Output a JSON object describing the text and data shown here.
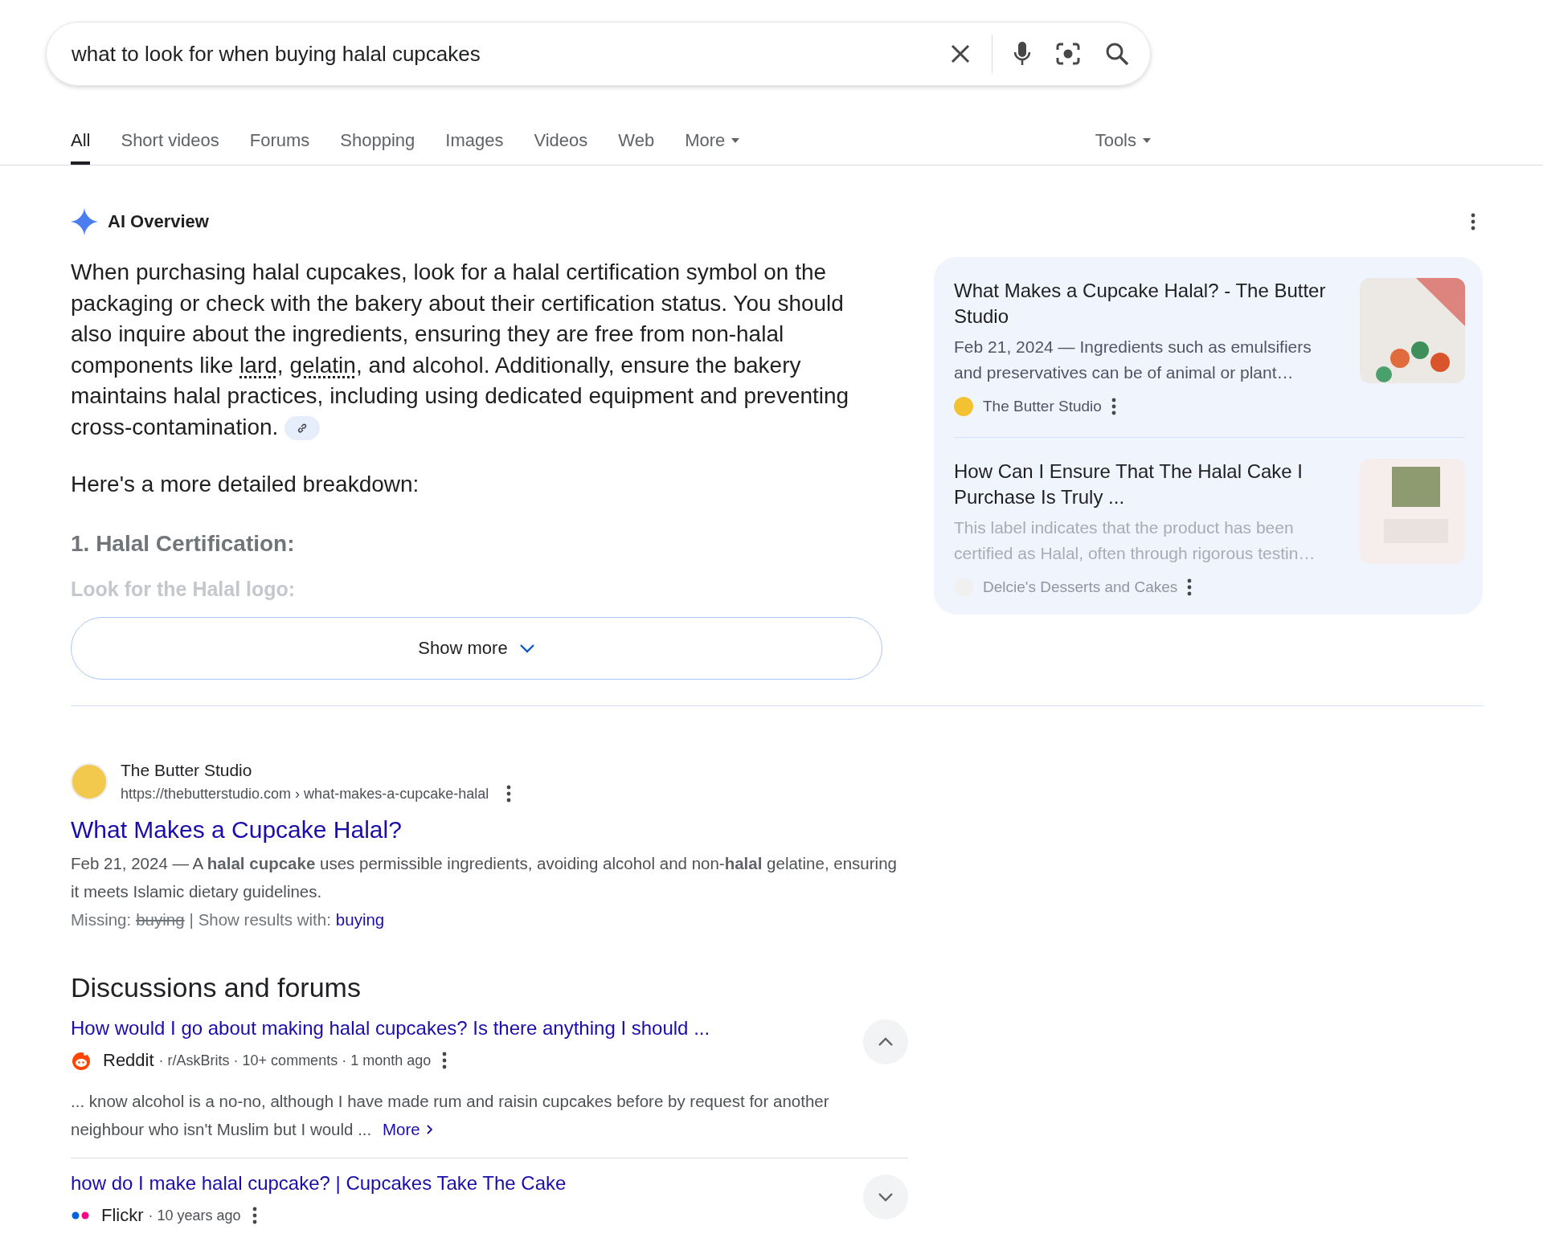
{
  "search": {
    "query": "what to look for when buying halal cupcakes"
  },
  "tabs": [
    {
      "label": "All",
      "selected": true,
      "kind": "link"
    },
    {
      "label": "Short videos",
      "selected": false,
      "kind": "link"
    },
    {
      "label": "Forums",
      "selected": false,
      "kind": "link"
    },
    {
      "label": "Shopping",
      "selected": false,
      "kind": "link"
    },
    {
      "label": "Images",
      "selected": false,
      "kind": "link"
    },
    {
      "label": "Videos",
      "selected": false,
      "kind": "link"
    },
    {
      "label": "Web",
      "selected": false,
      "kind": "link"
    },
    {
      "label": "More",
      "selected": false,
      "kind": "menu"
    }
  ],
  "tools": {
    "label": "Tools"
  },
  "ai_overview": {
    "title": "AI Overview",
    "paragraph": [
      {
        "kind": "text",
        "text": "When purchasing halal cupcakes, look for a halal certification symbol on the packaging or check with the bakery about their certification status. You should also inquire about the ingredients, ensuring they are free from non-halal components like "
      },
      {
        "kind": "term",
        "text": "lard"
      },
      {
        "kind": "text",
        "text": ", "
      },
      {
        "kind": "term",
        "text": "gelatin"
      },
      {
        "kind": "text",
        "text": ", and alcohol. Additionally, ensure the bakery maintains halal practices, including using dedicated equipment and preventing cross-contamination."
      }
    ],
    "breakdown_intro": "Here's a more detailed breakdown:",
    "heading": "1. Halal Certification:",
    "faded_line": "Look for the Halal logo:",
    "show_more": "Show more",
    "sources": [
      {
        "title": "What Makes a Cupcake Halal? - The Butter Studio",
        "snippet": "Feb 21, 2024 — Ingredients such as emulsifiers and preservatives can be of animal or plant…",
        "site": "The Butter Studio",
        "faded": false
      },
      {
        "title": "How Can I Ensure That The Halal Cake I Purchase Is Truly ...",
        "snippet": "This label indicates that the product has been certified as Halal, often through rigorous testin…",
        "site": "Delcie's Desserts and Cakes",
        "faded": true
      }
    ]
  },
  "result": {
    "site": "The Butter Studio",
    "url": "https://thebutterstudio.com › what-makes-a-cupcake-halal",
    "title": "What Makes a Cupcake Halal?",
    "snippet": "Feb 21, 2024 — A **halal cupcake** uses permissible ingredients, avoiding alcohol and non-**halal** gelatine, ensuring it meets Islamic dietary guidelines.",
    "missing_label": "Missing:",
    "missing_term": "buying",
    "show_with": "| Show results with:",
    "show_with_link": "buying"
  },
  "discussions": {
    "title": "Discussions and forums",
    "items": [
      {
        "title": "How would I go about making halal cupcakes? Is there anything I should ...",
        "kind": "reddit",
        "source": "Reddit",
        "meta": "· r/AskBrits · 10+ comments · 1 month ago",
        "expanded": true,
        "snippet": "... know alcohol is a no-no, although I have made rum and raisin cupcakes before by request for another neighbour who isn't Muslim but I would ...",
        "more": "More"
      },
      {
        "title": "how do I make halal cupcake? | Cupcakes Take The Cake",
        "kind": "flickr",
        "source": "Flickr",
        "meta": "· 10 years ago",
        "expanded": false
      }
    ]
  }
}
